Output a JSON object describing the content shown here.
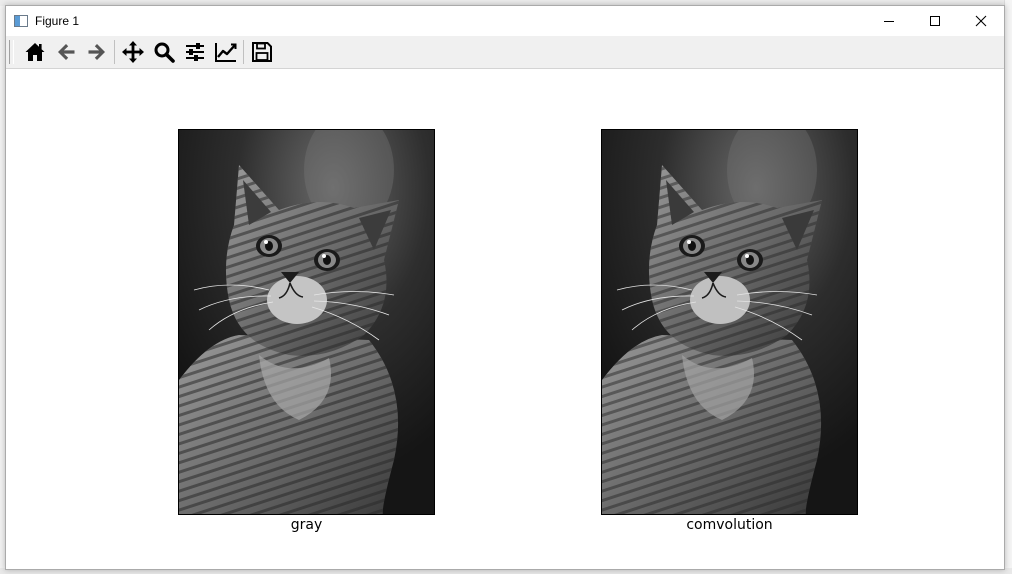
{
  "window": {
    "title": "Figure 1"
  },
  "toolbar": {
    "buttons": [
      {
        "name": "home-button",
        "icon": "home-icon"
      },
      {
        "name": "back-button",
        "icon": "arrow-left-icon"
      },
      {
        "name": "forward-button",
        "icon": "arrow-right-icon"
      },
      {
        "name": "pan-button",
        "icon": "move-icon"
      },
      {
        "name": "zoom-button",
        "icon": "magnifier-icon"
      },
      {
        "name": "configure-subplots-button",
        "icon": "sliders-icon"
      },
      {
        "name": "edit-axes-button",
        "icon": "line-chart-icon"
      },
      {
        "name": "save-button",
        "icon": "floppy-disk-icon"
      }
    ]
  },
  "figure": {
    "panels": [
      {
        "label": "gray"
      },
      {
        "label": "comvolution"
      }
    ]
  }
}
